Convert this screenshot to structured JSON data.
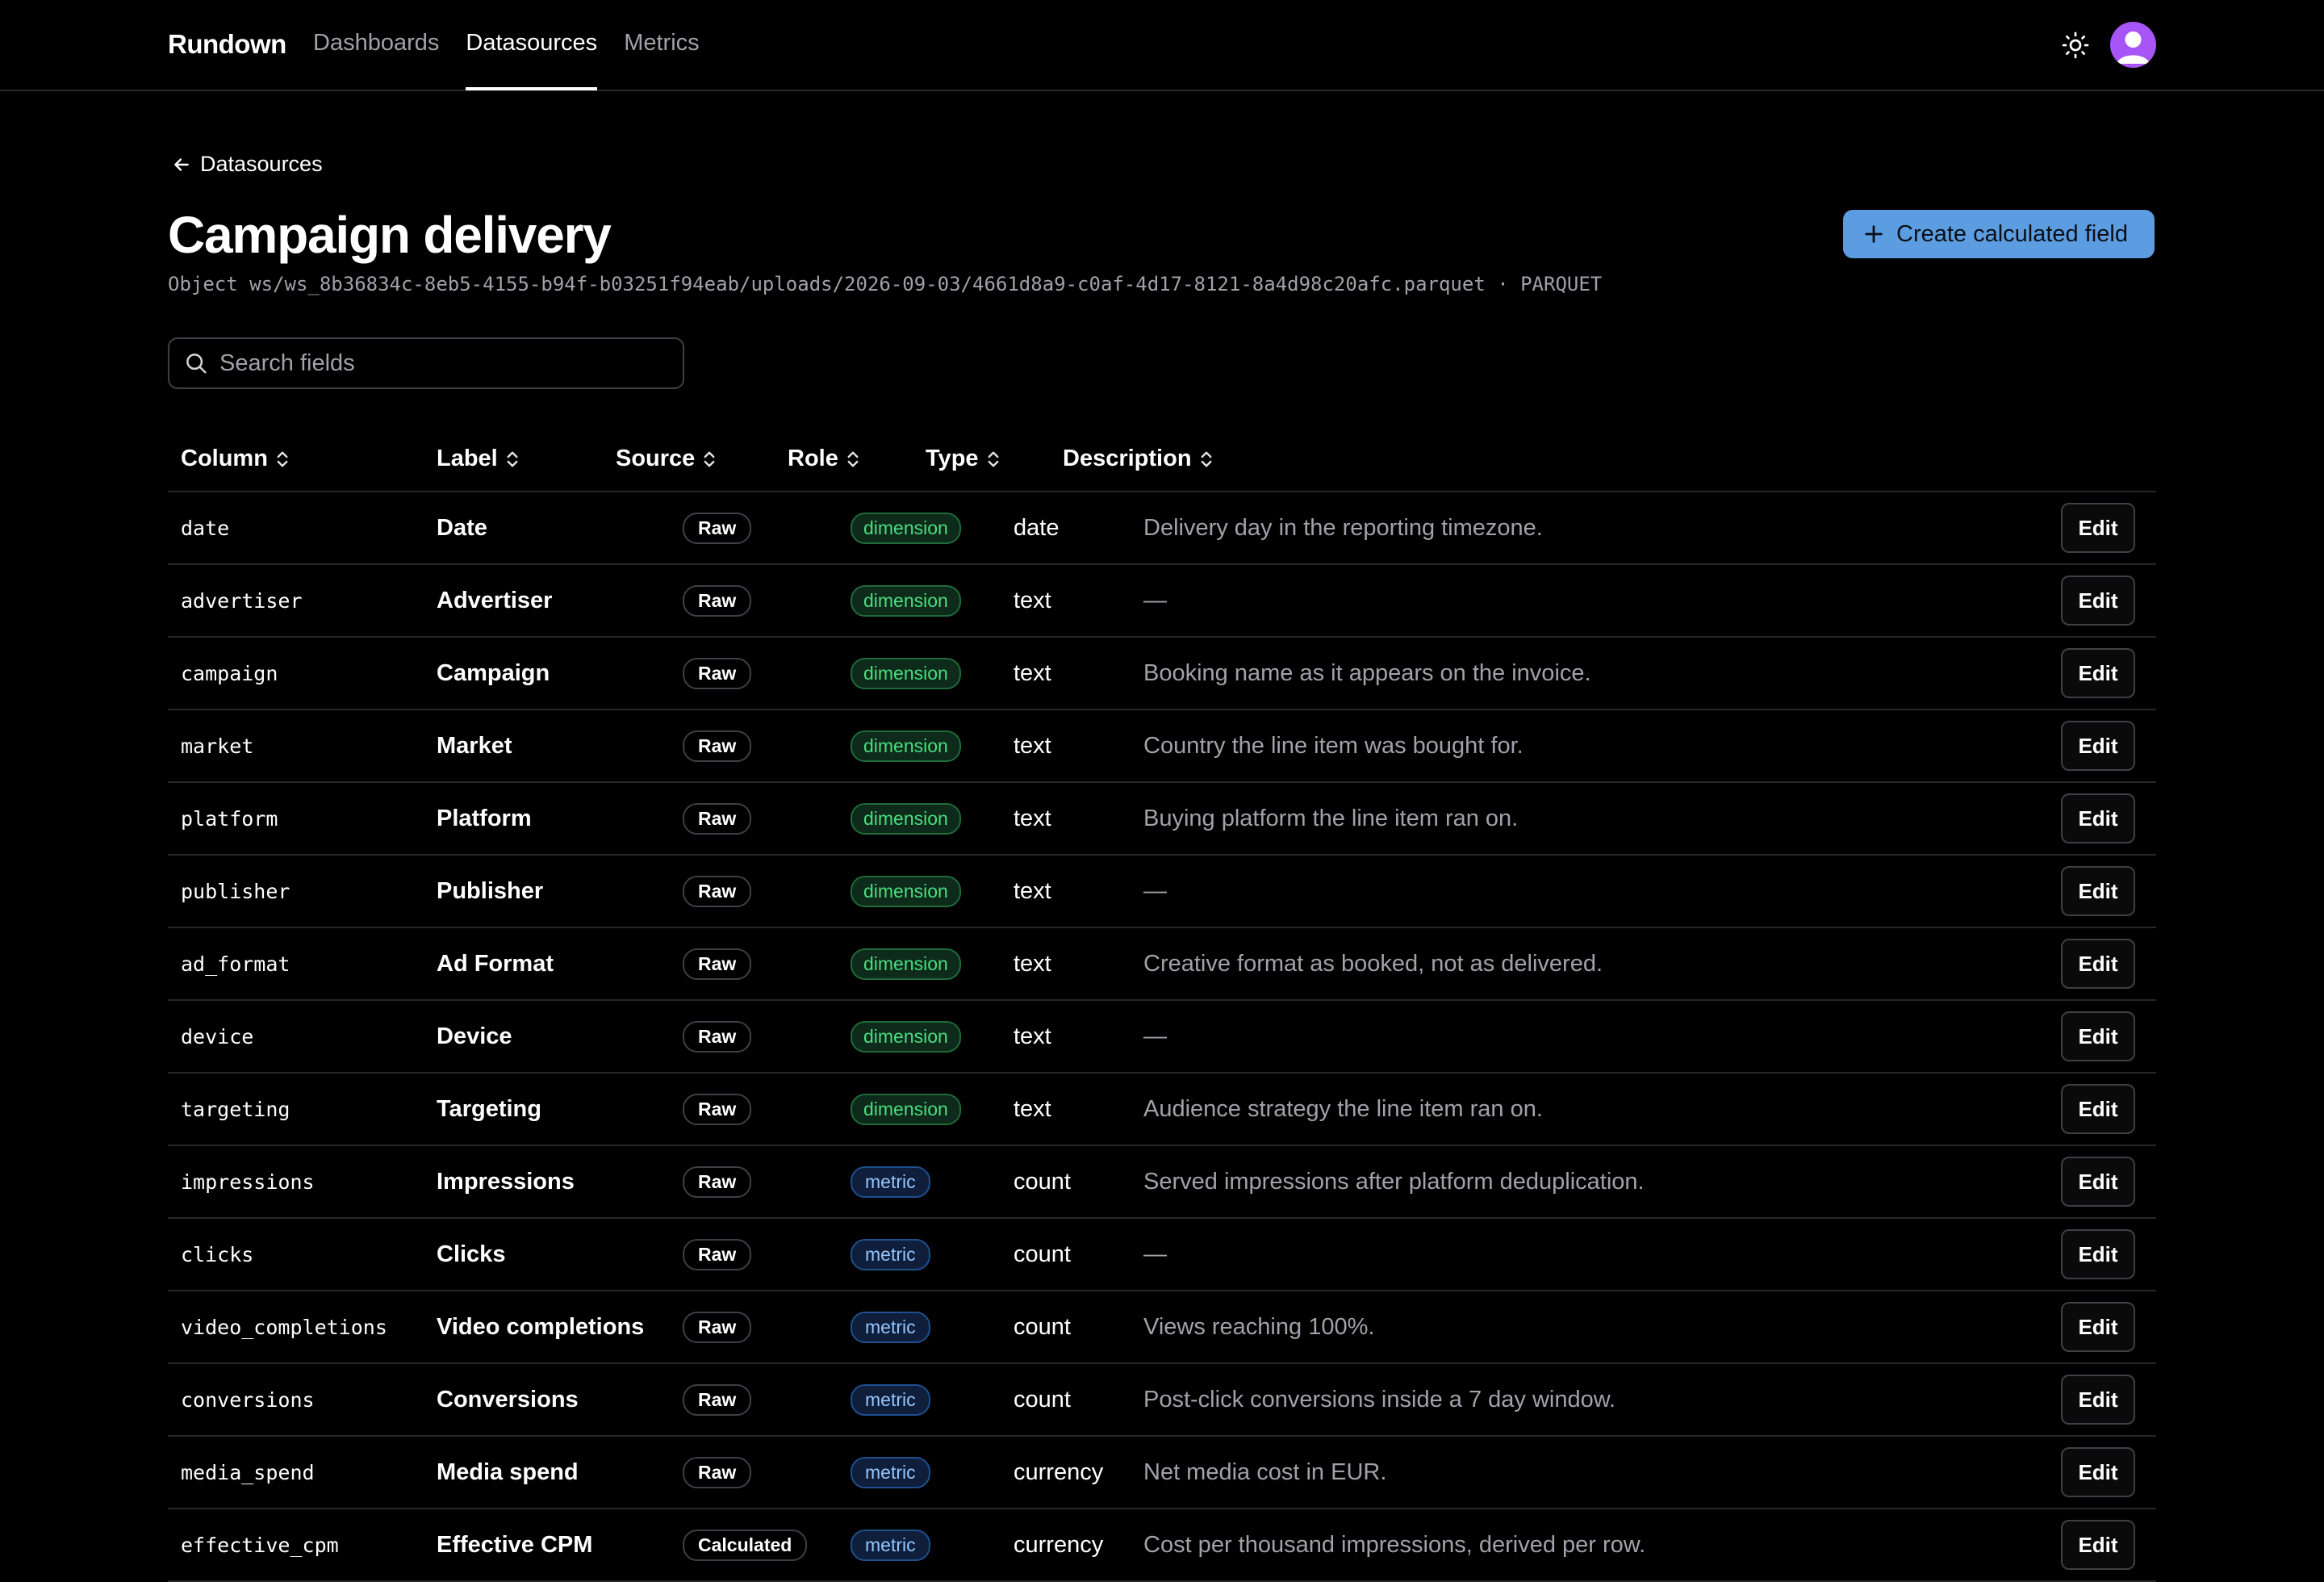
{
  "app": {
    "brand": "Rundown"
  },
  "nav": {
    "items": [
      {
        "label": "Dashboards",
        "active": false
      },
      {
        "label": "Datasources",
        "active": true
      },
      {
        "label": "Metrics",
        "active": false
      }
    ]
  },
  "header": {
    "theme_icon": "sun-icon",
    "avatar_icon": "user-icon"
  },
  "breadcrumb": {
    "back_label": "Datasources"
  },
  "page": {
    "title": "Campaign delivery",
    "subpath": "Object ws/ws_8b36834c-8eb5-4155-b94f-b03251f94eab/uploads/2026-09-03/4661d8a9-c0af-4d17-8121-8a4d98c20afc.parquet · PARQUET",
    "create_button": "Create calculated field"
  },
  "search": {
    "placeholder": "Search fields",
    "value": ""
  },
  "table": {
    "headers": [
      "Column",
      "Label",
      "Source",
      "Role",
      "Type",
      "Description"
    ],
    "edit_label": "Edit",
    "rows": [
      {
        "column": "date",
        "label": "Date",
        "source": "Raw",
        "role": "dimension",
        "type": "date",
        "description": "Delivery day in the reporting timezone."
      },
      {
        "column": "advertiser",
        "label": "Advertiser",
        "source": "Raw",
        "role": "dimension",
        "type": "text",
        "description": "—"
      },
      {
        "column": "campaign",
        "label": "Campaign",
        "source": "Raw",
        "role": "dimension",
        "type": "text",
        "description": "Booking name as it appears on the invoice."
      },
      {
        "column": "market",
        "label": "Market",
        "source": "Raw",
        "role": "dimension",
        "type": "text",
        "description": "Country the line item was bought for."
      },
      {
        "column": "platform",
        "label": "Platform",
        "source": "Raw",
        "role": "dimension",
        "type": "text",
        "description": "Buying platform the line item ran on."
      },
      {
        "column": "publisher",
        "label": "Publisher",
        "source": "Raw",
        "role": "dimension",
        "type": "text",
        "description": "—"
      },
      {
        "column": "ad_format",
        "label": "Ad Format",
        "source": "Raw",
        "role": "dimension",
        "type": "text",
        "description": "Creative format as booked, not as delivered."
      },
      {
        "column": "device",
        "label": "Device",
        "source": "Raw",
        "role": "dimension",
        "type": "text",
        "description": "—"
      },
      {
        "column": "targeting",
        "label": "Targeting",
        "source": "Raw",
        "role": "dimension",
        "type": "text",
        "description": "Audience strategy the line item ran on."
      },
      {
        "column": "impressions",
        "label": "Impressions",
        "source": "Raw",
        "role": "metric",
        "type": "count",
        "description": "Served impressions after platform deduplication."
      },
      {
        "column": "clicks",
        "label": "Clicks",
        "source": "Raw",
        "role": "metric",
        "type": "count",
        "description": "—"
      },
      {
        "column": "video_completions",
        "label": "Video completions",
        "source": "Raw",
        "role": "metric",
        "type": "count",
        "description": "Views reaching 100%."
      },
      {
        "column": "conversions",
        "label": "Conversions",
        "source": "Raw",
        "role": "metric",
        "type": "count",
        "description": "Post-click conversions inside a 7 day window."
      },
      {
        "column": "media_spend",
        "label": "Media spend",
        "source": "Raw",
        "role": "metric",
        "type": "currency",
        "description": "Net media cost in EUR."
      },
      {
        "column": "effective_cpm",
        "label": "Effective CPM",
        "source": "Calculated",
        "role": "metric",
        "type": "currency",
        "description": "Cost per thousand impressions, derived per row."
      }
    ]
  },
  "colors": {
    "background": "#000000",
    "accent": "#5b9de0",
    "dimension": "#4ade80",
    "metric": "#93c5fd",
    "muted": "#a1a1aa"
  }
}
